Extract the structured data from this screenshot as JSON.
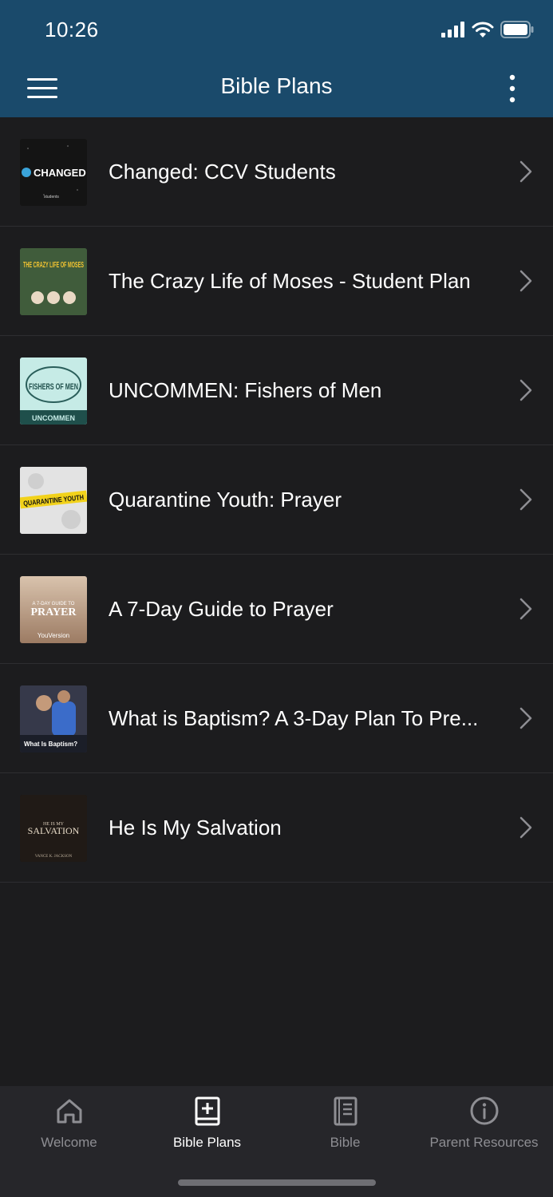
{
  "status": {
    "time": "10:26"
  },
  "header": {
    "title": "Bible Plans"
  },
  "plans": [
    {
      "label": "Changed: CCV Students",
      "thumb_text": "CHANGED",
      "thumb_sub": "students"
    },
    {
      "label": "The Crazy Life of Moses - Student Plan",
      "thumb_text": "THE CRAZY LIFE OF MOSES"
    },
    {
      "label": "UNCOMMEN: Fishers of Men",
      "thumb_text": "FISHERS OF MEN",
      "thumb_sub": "UNCOMMEN"
    },
    {
      "label": "Quarantine Youth: Prayer",
      "thumb_text": "QUARANTINE YOUTH"
    },
    {
      "label": "A 7-Day Guide to Prayer",
      "thumb_pre": "A 7-DAY GUIDE TO",
      "thumb_text": "PRAYER",
      "thumb_sub": "YouVersion"
    },
    {
      "label": "What is Baptism? A 3-Day Plan To Pre...",
      "thumb_sub": "What Is Baptism?"
    },
    {
      "label": "He Is My Salvation",
      "thumb_pre": "HE IS MY",
      "thumb_text": "SALVATION",
      "thumb_sub": "VANCE K. JACKSON"
    }
  ],
  "tabs": [
    {
      "label": "Welcome",
      "icon": "home-icon"
    },
    {
      "label": "Bible Plans",
      "icon": "bible-plus-icon",
      "active": true
    },
    {
      "label": "Bible",
      "icon": "book-icon"
    },
    {
      "label": "Parent Resources",
      "icon": "info-circle-icon"
    }
  ],
  "colors": {
    "header": "#1a4a6b",
    "background": "#1c1c1e",
    "tabbar": "#26262a",
    "active_tab": "#ffffff",
    "inactive_tab": "#8e8e93"
  }
}
